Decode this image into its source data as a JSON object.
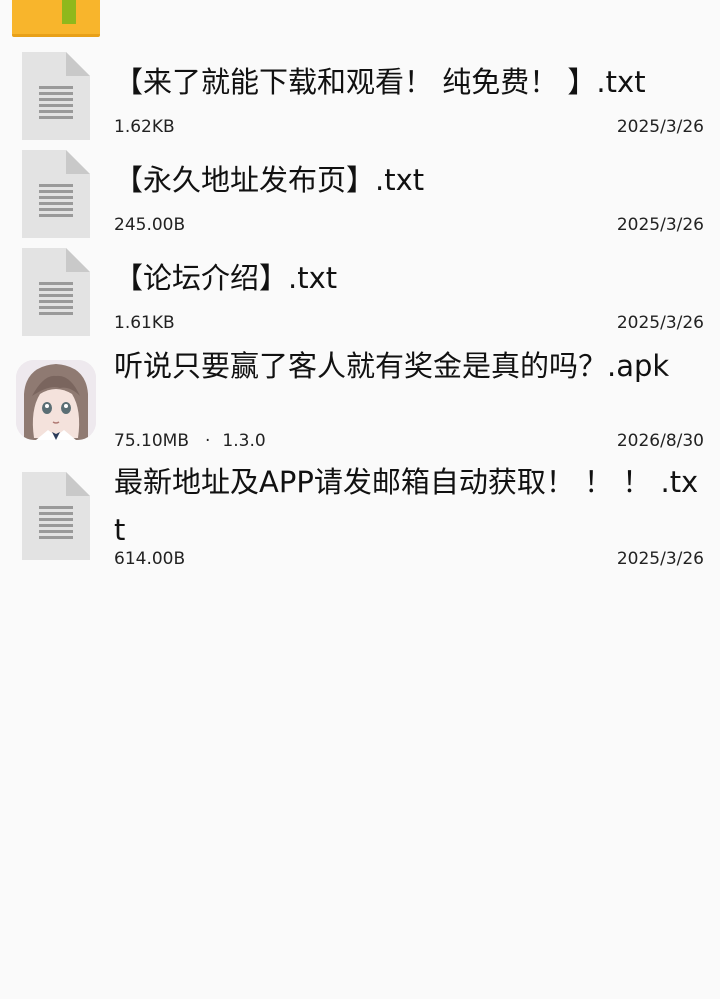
{
  "folder": {
    "icon": "folder-icon"
  },
  "files": [
    {
      "icon": "text-file-icon",
      "name": "【来了就能下载和观看！ 纯免费！ 】.txt",
      "size": "1.62KB",
      "date": "2025/3/26"
    },
    {
      "icon": "text-file-icon",
      "name": "【永久地址发布页】.txt",
      "size": "245.00B",
      "date": "2025/3/26"
    },
    {
      "icon": "text-file-icon",
      "name": "【论坛介绍】.txt",
      "size": "1.61KB",
      "date": "2025/3/26"
    },
    {
      "icon": "app-icon",
      "name": "听说只要赢了客人就有奖金是真的吗？.apk",
      "size": "75.10MB",
      "meta_separator": "·",
      "version": "1.3.0",
      "date": "2026/8/30"
    },
    {
      "icon": "text-file-icon",
      "name": "最新地址及APP请发邮箱自动获取！ ！ ！ .txt",
      "size": "614.00B",
      "date": "2025/3/26"
    }
  ]
}
